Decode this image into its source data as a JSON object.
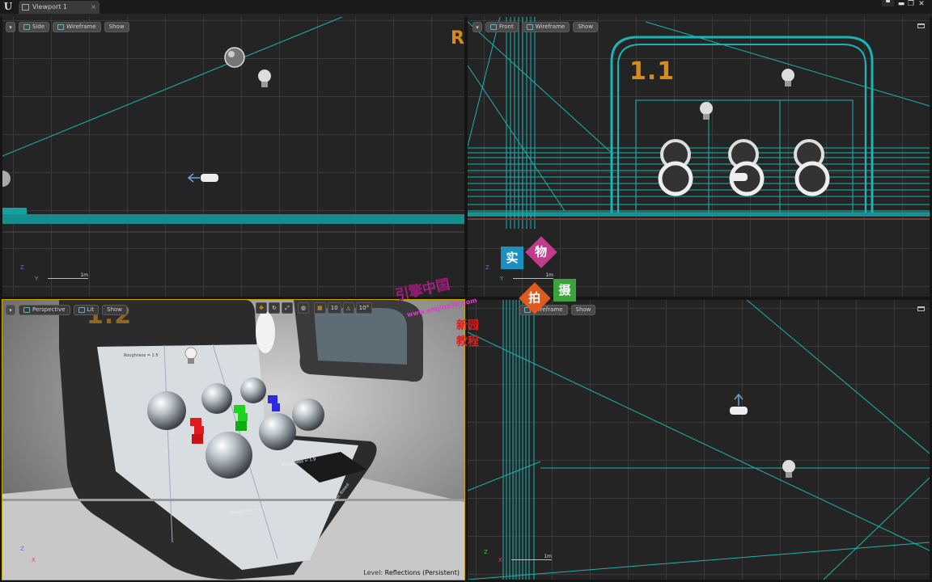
{
  "window": {
    "tab_title": "Viewport 1",
    "tab_close": "×",
    "logo": "U",
    "controls": {
      "restore": "▀",
      "minimize": "▬",
      "maximize": "❐",
      "close": "✕"
    }
  },
  "viewports": {
    "top_left": {
      "view": "Side",
      "mode": "Wireframe",
      "show": "Show",
      "axis_z": "Z",
      "axis_y": "Y",
      "scale": "1m",
      "edge_label": "R"
    },
    "top_right": {
      "view": "Front",
      "mode": "Wireframe",
      "show": "Show",
      "axis_z": "Z",
      "axis_y": "Y",
      "scale": "1m",
      "room_label": "1.1"
    },
    "bottom_left": {
      "view": "Perspective",
      "mode": "Lit",
      "show": "Show",
      "room_label": "1.2",
      "grid_value": "10",
      "angle_value": "10°",
      "panel_labels": [
        "Roughness = 1.5",
        "Roughness = 1.5",
        "Roughness = 1.9"
      ],
      "placard": "1.2 - Reflection from Static Baked",
      "level_label": "Level:",
      "level_name": "Reflections (Persistent)"
    },
    "bottom_right": {
      "mode": "Wireframe",
      "show": "Show",
      "axis_z": "Z",
      "axis_x": "X",
      "scale": "1m"
    }
  },
  "watermark": {
    "brand": "引擎中国",
    "url": "www.engine3d.com",
    "subtitle": "新园教程",
    "stamps": [
      "实",
      "物",
      "拍",
      "摄"
    ]
  },
  "colors": {
    "wire": "#1bb3b3",
    "accent": "#d88a1a",
    "selection": "#c9a100"
  }
}
